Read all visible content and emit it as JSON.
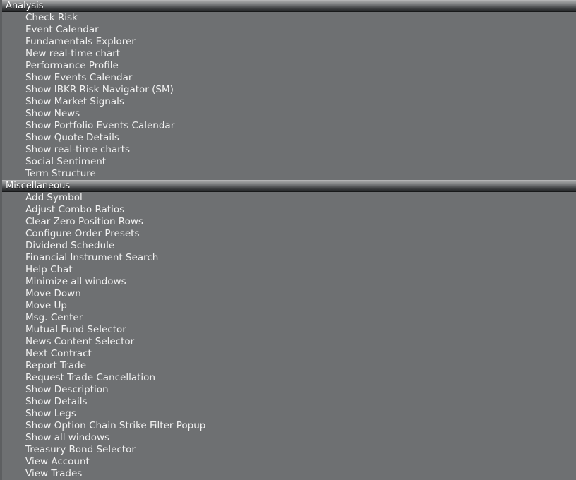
{
  "panel": {
    "background_color": "#6e7072",
    "text_color": "#f2f2f2",
    "header_text_color": "#ffffff"
  },
  "sections": [
    {
      "title": "Analysis",
      "items": [
        "Check Risk",
        "Event Calendar",
        "Fundamentals Explorer",
        "New real-time chart",
        "Performance Profile",
        "Show Events Calendar",
        "Show IBKR Risk Navigator (SM)",
        "Show Market Signals",
        "Show News",
        "Show Portfolio Events Calendar",
        "Show Quote Details",
        "Show real-time charts",
        "Social Sentiment",
        "Term Structure"
      ]
    },
    {
      "title": "Miscellaneous",
      "items": [
        "Add Symbol",
        "Adjust Combo Ratios",
        "Clear Zero Position Rows",
        "Configure Order Presets",
        "Dividend Schedule",
        "Financial Instrument Search",
        "Help Chat",
        "Minimize all windows",
        "Move Down",
        "Move Up",
        "Msg. Center",
        "Mutual Fund Selector",
        "News Content Selector",
        "Next Contract",
        "Report Trade",
        "Request Trade Cancellation",
        "Show Description",
        "Show Details",
        "Show Legs",
        "Show Option Chain Strike Filter Popup",
        "Show all windows",
        "Treasury Bond Selector",
        "View Account",
        "View Trades"
      ]
    }
  ]
}
